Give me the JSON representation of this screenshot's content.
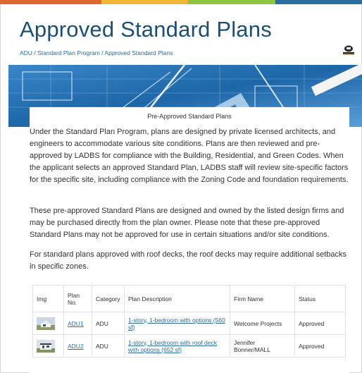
{
  "colors": {
    "top_bar": [
      "#e0662e",
      "#f2b632",
      "#8cc63f",
      "#2e6d9a"
    ],
    "title": "#1d4f73",
    "link": "#2e6d9a",
    "banner": "#1f6fb3"
  },
  "header": {
    "title": "Approved Standard Plans",
    "breadcrumb": {
      "items": [
        "ADU",
        "Standard Plan Program",
        "Approved Standard Plans"
      ],
      "separator": " / "
    },
    "translate_icon": "translate-icon"
  },
  "banner": {
    "image": "blueprint-drafting-banner"
  },
  "main": {
    "intro_title": "Pre-Approved Standard Plans",
    "paragraphs": [
      "Under the Standard Plan Program, plans are designed by private licensed architects, and engineers to accommodate various site conditions. Plans are then reviewed and pre-approved by LADBS for compliance with the Building, Residential, and Green Codes. When the applicant selects an approved Standard Plan, LADBS staff will review site-specific factors for the specific site, including compliance with the Zoning Code and foundation requirements.",
      "These pre-approved Standard Plans are designed and owned by the listed design firms and may be purchased directly from the plan owner. Please note that these pre-approved Standard Plans may not be approved for use in certain situations and/or site conditions.",
      "For standard plans approved with roof decks, the roof decks may require additional setbacks in specific zones."
    ],
    "table": {
      "headers": [
        "Img",
        "Plan No.",
        "Category",
        "Plan Description",
        "Firm Name",
        "Status"
      ],
      "rows": [
        {
          "img": "house-thumbnail",
          "plan_no": "ADU1",
          "category": "ADU",
          "description": "1-story, 1-bedroom with options (560 sf)",
          "firm": "Welcome Projects",
          "status": "Approved"
        },
        {
          "img": "house-thumbnail",
          "plan_no": "ADU2",
          "category": "ADU",
          "description": "1-story, 1-bedroom with roof deck with options (652 sf)",
          "firm": "Jennifer Bonner/MALL",
          "status": "Approved"
        }
      ]
    }
  }
}
